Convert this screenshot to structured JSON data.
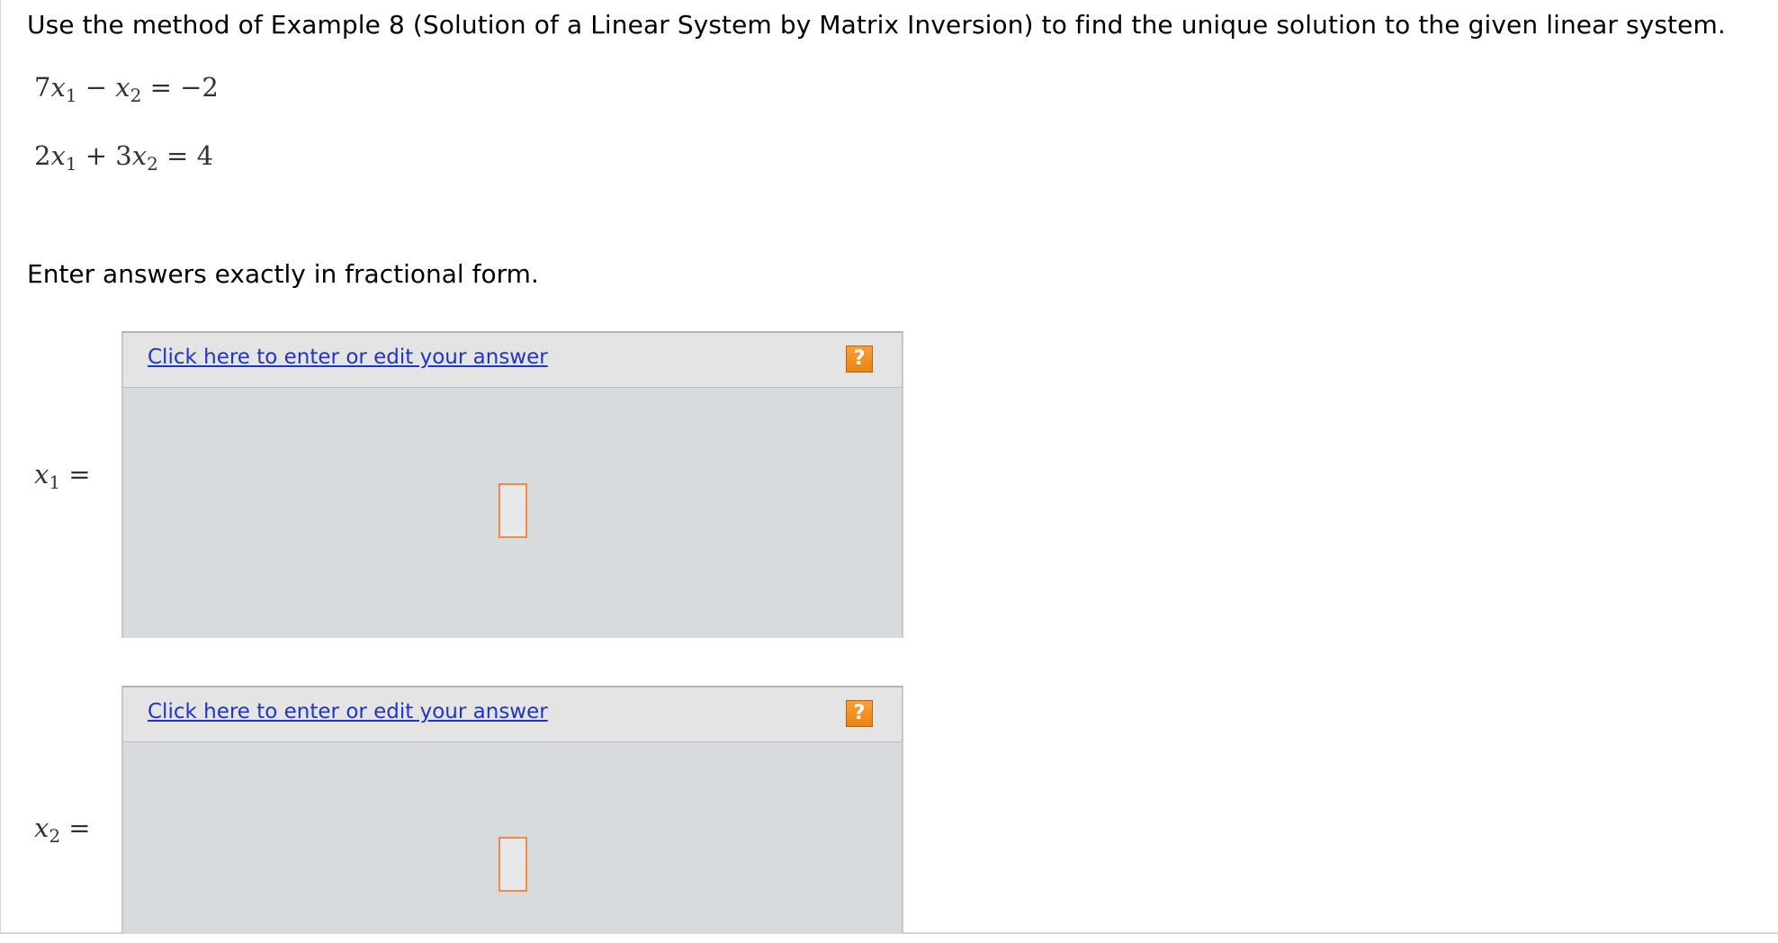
{
  "question": {
    "prompt": "Use the method of Example 8 (Solution of a Linear System by Matrix Inversion) to find the unique solution to the given linear system.",
    "equations": [
      {
        "c1": "7",
        "v1": "x",
        "s1": "1",
        "op": " − ",
        "c2": "",
        "v2": "x",
        "s2": "2",
        "rhs": " = −2"
      },
      {
        "c1": "2",
        "v1": "x",
        "s1": "1",
        "op": " + ",
        "c2": "3",
        "v2": "x",
        "s2": "2",
        "rhs": " = 4"
      }
    ],
    "instruction": "Enter answers exactly in fractional form."
  },
  "answers": [
    {
      "var": "x",
      "sub": "1",
      "eq": " =",
      "link_text": "Click here to enter or edit your answer",
      "help": "?"
    },
    {
      "var": "x",
      "sub": "2",
      "eq": " =",
      "link_text": "Click here to enter or edit your answer",
      "help": "?"
    }
  ],
  "colors": {
    "link": "#1f35c8",
    "help_icon": "#f08a1c",
    "answer_bg": "#d8dbde",
    "slot_border": "#f08a4b"
  }
}
